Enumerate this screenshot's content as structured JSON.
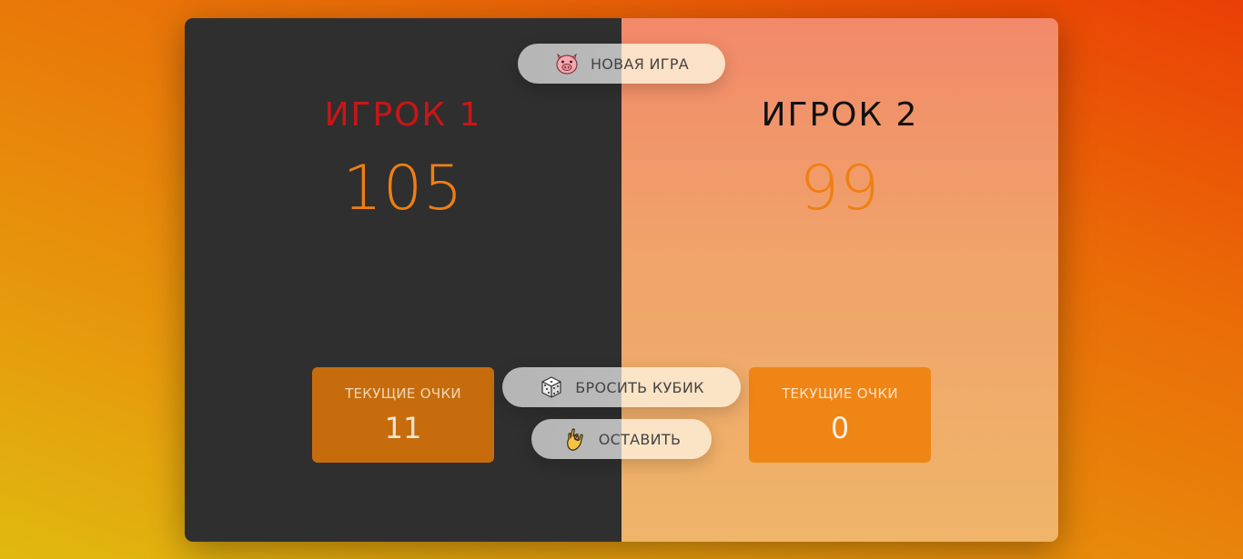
{
  "players": [
    {
      "name": "ИГРОК 1",
      "total_score": "105",
      "current_label": "ТЕКУЩИЕ ОЧКИ",
      "current_score": "11",
      "active": true
    },
    {
      "name": "ИГРОК 2",
      "total_score": "99",
      "current_label": "ТЕКУЩИЕ ОЧКИ",
      "current_score": "0",
      "active": false
    }
  ],
  "buttons": {
    "new_game": {
      "label": "НОВАЯ ИГРА",
      "icon": "pig-icon"
    },
    "roll_dice": {
      "label": "БРОСИТЬ КУБИК",
      "icon": "dice-icon"
    },
    "hold": {
      "label": "ОСТАВИТЬ",
      "icon": "ok-hand-icon"
    }
  },
  "colors": {
    "active_player_name": "#c91616",
    "score": "#ef7f12",
    "left_panel": "#2f2f2f"
  }
}
